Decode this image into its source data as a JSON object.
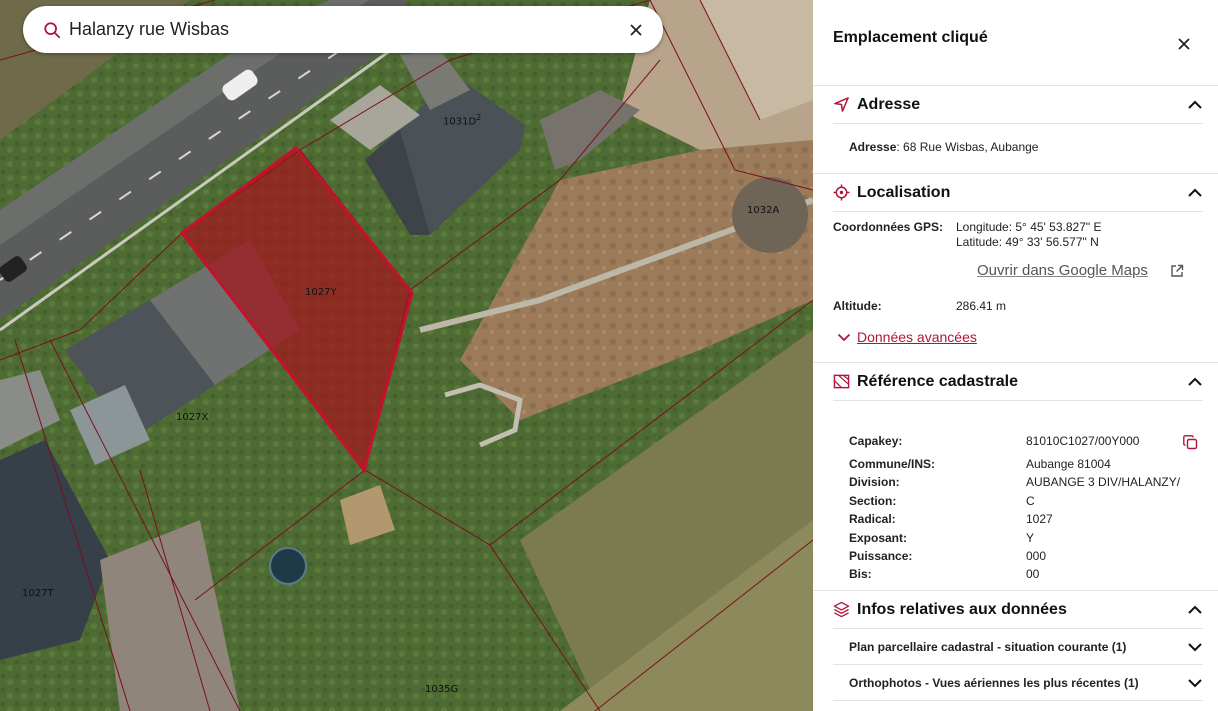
{
  "search": {
    "value": "Halanzy rue Wisbas"
  },
  "map": {
    "labels": {
      "p1031d": "1031D",
      "p1031d_sup": "2",
      "p1032a": "1032A",
      "p1027y": "1027Y",
      "p1027x": "1027X",
      "p1027t": "1027T",
      "p1035g": "1035G"
    }
  },
  "panel": {
    "title": "Emplacement cliqué",
    "address": {
      "title": "Adresse",
      "label": "Adresse",
      "value": ": 68 Rue Wisbas, Aubange"
    },
    "location": {
      "title": "Localisation",
      "gps_label": "Coordonnées GPS:",
      "longitude": "Longitude: 5° 45' 53.827\" E",
      "latitude": "Latitude: 49° 33' 56.577\" N",
      "gmaps_link": "Ouvrir dans Google Maps",
      "altitude_label": "Altitude:",
      "altitude_value": "286.41 m",
      "advanced": "Données avancées"
    },
    "cadastre": {
      "title": "Référence cadastrale",
      "rows": [
        {
          "label": "Capakey:",
          "value": "81010C1027/00Y000"
        },
        {
          "label": "Commune/INS:",
          "value": "Aubange 81004"
        },
        {
          "label": "Division:",
          "value": "AUBANGE 3 DIV/HALANZY/"
        },
        {
          "label": "Section:",
          "value": "C"
        },
        {
          "label": "Radical:",
          "value": "1027"
        },
        {
          "label": "Exposant:",
          "value": "Y"
        },
        {
          "label": "Puissance:",
          "value": "000"
        },
        {
          "label": "Bis:",
          "value": "00"
        }
      ]
    },
    "data_info": {
      "title": "Infos relatives aux données",
      "items": [
        "Plan parcellaire cadastral - situation courante (1)",
        "Orthophotos - Vues aériennes les plus récentes (1)"
      ]
    }
  },
  "colors": {
    "accent": "#b0163a",
    "parcel_fill": "#a3131c",
    "parcel_line": "#c8102e"
  },
  "icons": {
    "search": "search-icon",
    "close": "close-icon",
    "address": "navigation-arrow-icon",
    "location": "crosshair-icon",
    "cadastre": "cadastral-map-icon",
    "data": "layers-icon",
    "external": "external-link-icon",
    "copy": "copy-icon",
    "chevron_up": "chevron-up-icon",
    "chevron_down": "chevron-down-icon"
  }
}
